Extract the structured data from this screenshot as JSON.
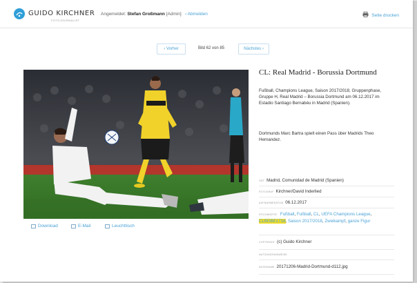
{
  "header": {
    "logo_text": "GUIDO KIRCHNER",
    "logo_sub": "FOTOJOURNALIST",
    "login_label": "Angemeldet:",
    "user_name": "Stefan Großmann",
    "user_role": "[Admin]",
    "logout_label": "› Abmelden",
    "print_label": "Seite drucken"
  },
  "pager": {
    "prev_label": "‹ Vorher",
    "counter": "Bild 62 von 85",
    "next_label": "Nächstes ›"
  },
  "actions": {
    "download": "Download",
    "email": "E-Mail",
    "lightbox": "Leuchttisch"
  },
  "detail": {
    "title": "CL: Real Madrid - Borussia Dortmund",
    "description": "Fußball, Champions League, Saison 2017/2018, Gruppenphase, Gruppe H, Real Madrid – Borussia Dortmund am 06.12.2017 im Estadio Santiago Bernabéu in Madrid (Spanien).",
    "caption": "Dortmunds Marc Bartra spielt einen Pass über Madrids Theo Hernandez."
  },
  "metadata": {
    "ort_label": "Ort",
    "ort_value": "Madrid, Comunidad de Madrid (Spanien)",
    "fotograf_label": "Fotograf",
    "fotograf_value": "Kirchner/David Inderlied",
    "datum_label": "Aufnahmedatum",
    "datum_value": "06.12.2017",
    "stichworte_label": "Stichworte",
    "kw_fussball": "Fußball",
    "kw_fussball2": "Fußball",
    "kw_cl": "CL",
    "kw_uefa": "UEFA Champions League",
    "kw_highlight": "CLBDBE1718",
    "kw_saison": "Saison 2017/2018",
    "kw_zweikampf": "Zweikampf",
    "kw_figur": "ganze Figur",
    "copyright_label": "Copyright",
    "copyright_value": "(c) Guido Kirchner",
    "nutzung_label": "Nutzungshinweise",
    "datei_label": "Dateiname",
    "datei_value": "20171206-Madrid-Dortmund-d112.jpg"
  },
  "colors": {
    "accent": "#4aa2d6",
    "logo": "#2f9fd8",
    "highlight": "#f2dd2a"
  }
}
